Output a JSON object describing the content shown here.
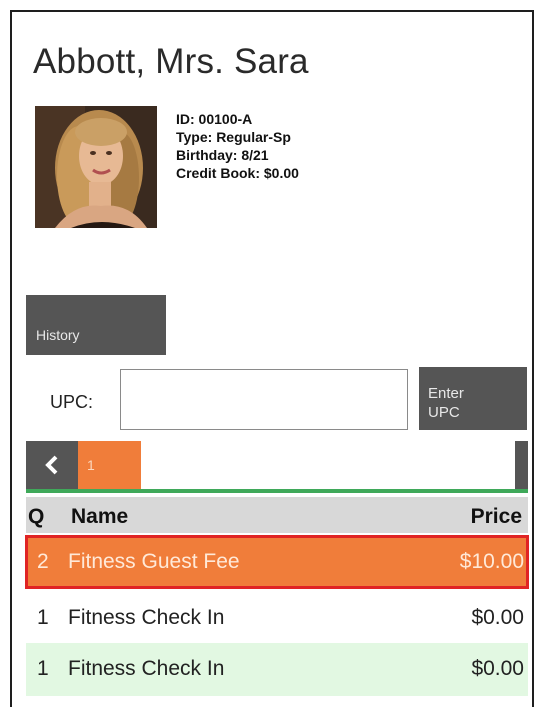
{
  "customer": {
    "name": "Abbott, Mrs. Sara",
    "id_line": "ID: 00100-A",
    "type_line": "Type: Regular-Sp",
    "birthday_line": "Birthday: 8/21",
    "credit_line": "Credit Book: $0.00"
  },
  "actions": {
    "history_label": "History"
  },
  "upc": {
    "label": "UPC:",
    "value": "",
    "enter_label_line1": "Enter",
    "enter_label_line2": "UPC"
  },
  "pager": {
    "prev_icon": "chevron-left-icon",
    "current_page": "1",
    "next_icon": "chevron-right-icon"
  },
  "table": {
    "columns": {
      "q": "Q",
      "name": "Name",
      "price": "Price"
    },
    "rows": [
      {
        "q": "2",
        "name": "Fitness Guest Fee",
        "price": "$10.00",
        "selected": true
      },
      {
        "q": "1",
        "name": "Fitness Check In",
        "price": "$0.00",
        "selected": false
      },
      {
        "q": "1",
        "name": "Fitness Check In",
        "price": "$0.00",
        "selected": false
      }
    ]
  },
  "colors": {
    "accent": "#f07d3a",
    "button_gray": "#555555",
    "selection_border": "#e02424",
    "alt_row": "#e2f8e2",
    "divider_green": "#3fa95a"
  }
}
